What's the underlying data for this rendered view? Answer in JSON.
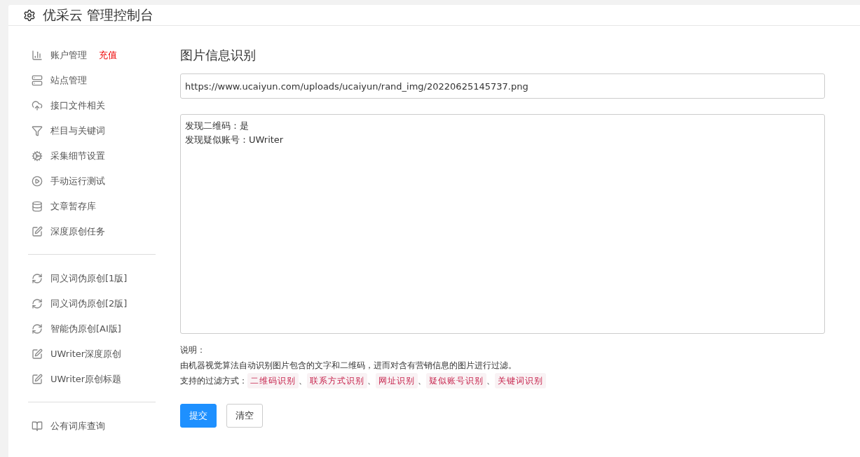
{
  "header": {
    "title": "优采云 管理控制台"
  },
  "sidebar": {
    "groups": [
      {
        "items": [
          {
            "label": "账户管理",
            "badge": "充值"
          },
          {
            "label": "站点管理"
          },
          {
            "label": "接口文件相关"
          },
          {
            "label": "栏目与关键词"
          },
          {
            "label": "采集细节设置"
          },
          {
            "label": "手动运行测试"
          },
          {
            "label": "文章暂存库"
          },
          {
            "label": "深度原创任务"
          }
        ]
      },
      {
        "items": [
          {
            "label": "同义词伪原创[1版]"
          },
          {
            "label": "同义词伪原创[2版]"
          },
          {
            "label": "智能伪原创[AI版]"
          },
          {
            "label": "UWriter深度原创"
          },
          {
            "label": "UWriter原创标题"
          }
        ]
      },
      {
        "items": [
          {
            "label": "公有词库查询"
          }
        ]
      }
    ]
  },
  "main": {
    "title": "图片信息识别",
    "url_field": {
      "value": "https://www.ucaiyun.com/uploads/ucaiyun/rand_img/20220625145737.png"
    },
    "result_box": {
      "lines": [
        "发现二维码：是",
        "发现疑似账号：UWriter"
      ]
    },
    "notes_title": "说明：",
    "description": "由机器视觉算法自动识别图片包含的文字和二维码，进而对含有营销信息的图片进行过滤。",
    "filters_label": "支持的过滤方式：",
    "filters": [
      "二维码识别",
      "联系方式识别",
      "网址识别",
      "疑似账号识别",
      "关键词识别"
    ],
    "filter_separator": "、",
    "buttons": [
      {
        "label": "提交",
        "kind": "primary"
      },
      {
        "label": "清空",
        "kind": "default"
      }
    ]
  }
}
